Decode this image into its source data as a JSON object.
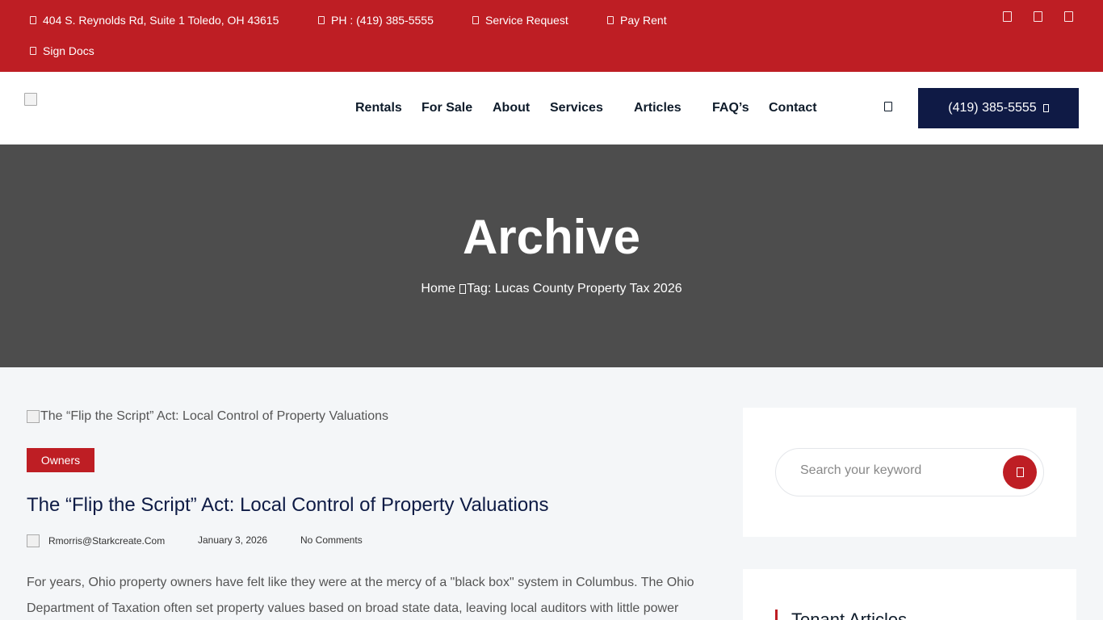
{
  "topbar": {
    "address": "404 S. Reynolds Rd, Suite 1 Toledo, OH 43615",
    "phone": "PH : (419) 385-5555",
    "service_request": "Service Request",
    "pay_rent": "Pay Rent",
    "sign_docs": "Sign Docs",
    "icons": [
      "map-marker-icon",
      "phone-icon",
      "wrench-icon",
      "credit-card-icon",
      "document-icon"
    ],
    "social_icons": [
      "facebook-icon",
      "twitter-icon",
      "instagram-icon"
    ],
    "color": "#be1e24"
  },
  "header": {
    "nav": [
      "Rentals",
      "For Sale",
      "About",
      "Services",
      "Articles",
      "FAQ’s",
      "Contact"
    ],
    "phone_button": "(419) 385-5555",
    "phone_button_color": "#0f1a45"
  },
  "banner": {
    "title": "Archive",
    "breadcrumb_home": "Home",
    "breadcrumb_current": "Tag: Lucas County Property Tax 2026"
  },
  "post": {
    "image_alt": "The “Flip the Script” Act: Local Control of Property Valuations",
    "category": "Owners",
    "title": "The “Flip the Script” Act: Local Control of Property Valuations",
    "author": "Rmorris@Starkcreate.Com",
    "date": "January 3, 2026",
    "comments": "No Comments",
    "excerpt": "For years, Ohio property owners have felt like they were at the mercy of a \"black box\" system in Columbus. The Ohio Department of Taxation often set property values based on broad state data, leaving local auditors with little power"
  },
  "sidebar": {
    "search_placeholder": "Search your keyword",
    "widget_title": "Tenant Articles"
  }
}
